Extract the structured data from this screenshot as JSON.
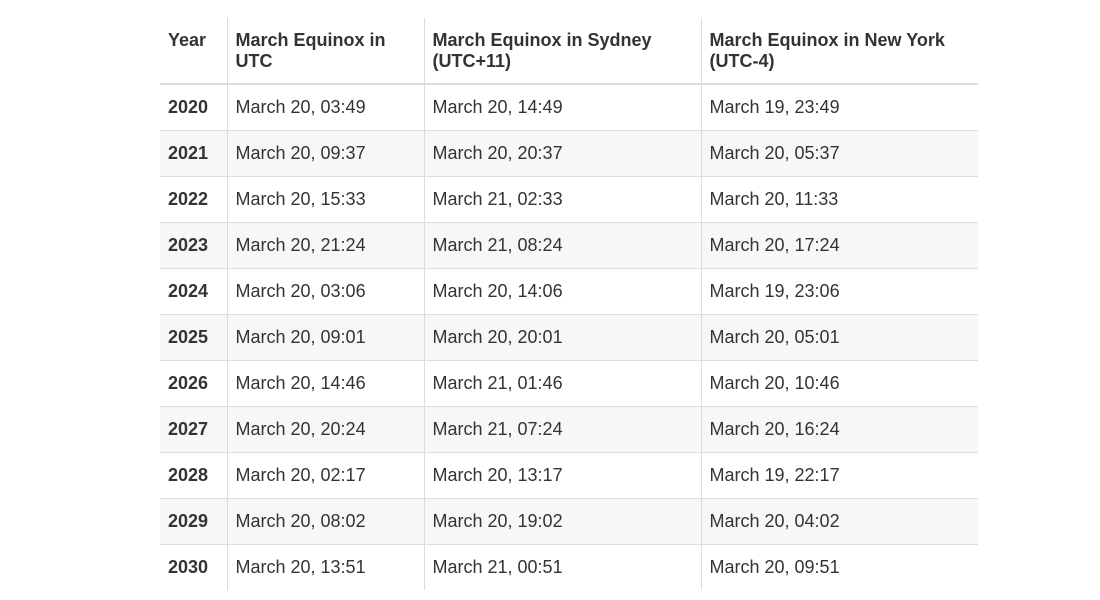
{
  "table": {
    "headers": [
      "Year",
      "March Equinox in UTC",
      "March Equinox in Sydney (UTC+11)",
      "March Equinox in New York (UTC-4)"
    ],
    "rows": [
      [
        "2020",
        "March 20, 03:49",
        "March 20, 14:49",
        "March 19, 23:49"
      ],
      [
        "2021",
        "March 20, 09:37",
        "March 20, 20:37",
        "March 20, 05:37"
      ],
      [
        "2022",
        "March 20, 15:33",
        "March 21, 02:33",
        "March 20, 11:33"
      ],
      [
        "2023",
        "March 20, 21:24",
        "March 21, 08:24",
        "March 20, 17:24"
      ],
      [
        "2024",
        "March 20, 03:06",
        "March 20, 14:06",
        "March 19, 23:06"
      ],
      [
        "2025",
        "March 20, 09:01",
        "March 20, 20:01",
        "March 20, 05:01"
      ],
      [
        "2026",
        "March 20, 14:46",
        "March 21, 01:46",
        "March 20, 10:46"
      ],
      [
        "2027",
        "March 20, 20:24",
        "March 21, 07:24",
        "March 20, 16:24"
      ],
      [
        "2028",
        "March 20, 02:17",
        "March 20, 13:17",
        "March 19, 22:17"
      ],
      [
        "2029",
        "March 20, 08:02",
        "March 20, 19:02",
        "March 20, 04:02"
      ],
      [
        "2030",
        "March 20, 13:51",
        "March 21, 00:51",
        "March 20, 09:51"
      ]
    ]
  }
}
